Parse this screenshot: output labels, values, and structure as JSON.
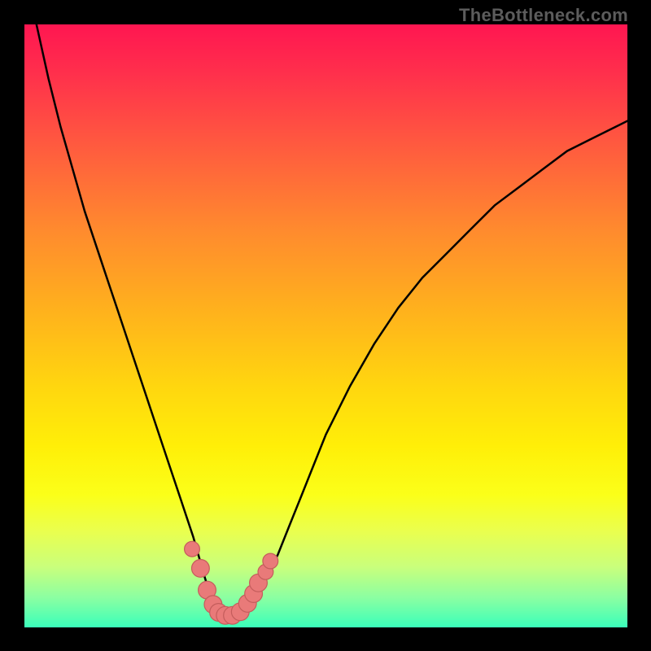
{
  "brand": "TheBottleneck.com",
  "colors": {
    "frame": "#000000",
    "curve_stroke": "#000000",
    "marker_fill": "#e97a79",
    "marker_stroke": "#c45d5c",
    "brand_text": "#5c5c5c"
  },
  "chart_data": {
    "type": "line",
    "title": "",
    "xlabel": "",
    "ylabel": "",
    "xlim": [
      0,
      100
    ],
    "ylim": [
      0,
      100
    ],
    "x": [
      0,
      2,
      4,
      6,
      8,
      10,
      12,
      14,
      16,
      18,
      20,
      22,
      24,
      26,
      28,
      30,
      31,
      32,
      33,
      34,
      35,
      36,
      38,
      40,
      42,
      44,
      46,
      48,
      50,
      54,
      58,
      62,
      66,
      70,
      74,
      78,
      82,
      86,
      90,
      94,
      98,
      100
    ],
    "y": [
      109,
      100,
      91,
      83,
      76,
      69,
      63,
      57,
      51,
      45,
      39,
      33,
      27,
      21,
      15,
      8,
      5,
      3,
      2,
      2,
      2,
      3,
      5,
      8,
      12,
      17,
      22,
      27,
      32,
      40,
      47,
      53,
      58,
      62,
      66,
      70,
      73,
      76,
      79,
      81,
      83,
      84
    ],
    "markers": [
      {
        "x": 27.8,
        "y": 13.0,
        "r": 1.2
      },
      {
        "x": 29.2,
        "y": 9.8,
        "r": 1.6
      },
      {
        "x": 30.3,
        "y": 6.2,
        "r": 1.6
      },
      {
        "x": 31.3,
        "y": 3.8,
        "r": 1.6
      },
      {
        "x": 32.2,
        "y": 2.5,
        "r": 1.6
      },
      {
        "x": 33.3,
        "y": 2.0,
        "r": 1.6
      },
      {
        "x": 34.5,
        "y": 2.0,
        "r": 1.6
      },
      {
        "x": 35.8,
        "y": 2.6,
        "r": 1.6
      },
      {
        "x": 37.0,
        "y": 4.0,
        "r": 1.6
      },
      {
        "x": 38.0,
        "y": 5.6,
        "r": 1.6
      },
      {
        "x": 38.8,
        "y": 7.4,
        "r": 1.6
      },
      {
        "x": 40.0,
        "y": 9.2,
        "r": 1.2
      },
      {
        "x": 40.8,
        "y": 11.0,
        "r": 1.2
      }
    ]
  }
}
